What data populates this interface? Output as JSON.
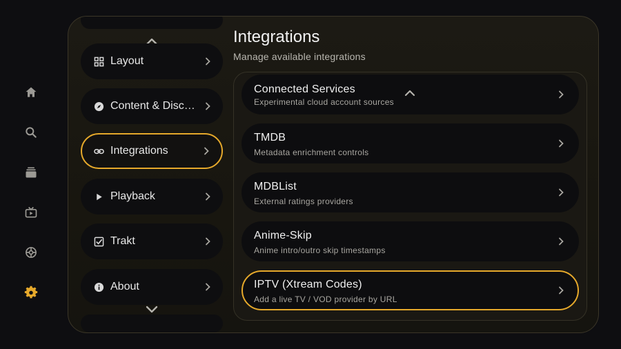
{
  "colors": {
    "accent": "#e6a92b",
    "background": "#0e0e11",
    "card": "#0d0d0f"
  },
  "nav_rail": [
    {
      "icon": "home-icon",
      "active": false
    },
    {
      "icon": "search-icon",
      "active": false
    },
    {
      "icon": "library-icon",
      "active": false
    },
    {
      "icon": "live-tv-icon",
      "active": false
    },
    {
      "icon": "addons-icon",
      "active": false
    },
    {
      "icon": "settings-icon",
      "active": true
    }
  ],
  "categories": [
    {
      "label": "Layout",
      "icon": "grid-icon"
    },
    {
      "label": "Content & Discovery",
      "icon": "compass-icon"
    },
    {
      "label": "Integrations",
      "icon": "link-icon",
      "active": true
    },
    {
      "label": "Playback",
      "icon": "play-icon"
    },
    {
      "label": "Trakt",
      "icon": "checkbox-icon"
    },
    {
      "label": "About",
      "icon": "info-icon"
    }
  ],
  "header": {
    "title": "Integrations",
    "subtitle": "Manage available integrations"
  },
  "integrations": [
    {
      "title": "Connected Services",
      "description": "Experimental cloud account sources"
    },
    {
      "title": "TMDB",
      "description": "Metadata enrichment controls"
    },
    {
      "title": "MDBList",
      "description": "External ratings providers"
    },
    {
      "title": "Anime-Skip",
      "description": "Anime intro/outro skip timestamps"
    },
    {
      "title": "IPTV (Xtream Codes)",
      "description": "Add a live TV / VOD provider by URL",
      "active": true
    }
  ]
}
